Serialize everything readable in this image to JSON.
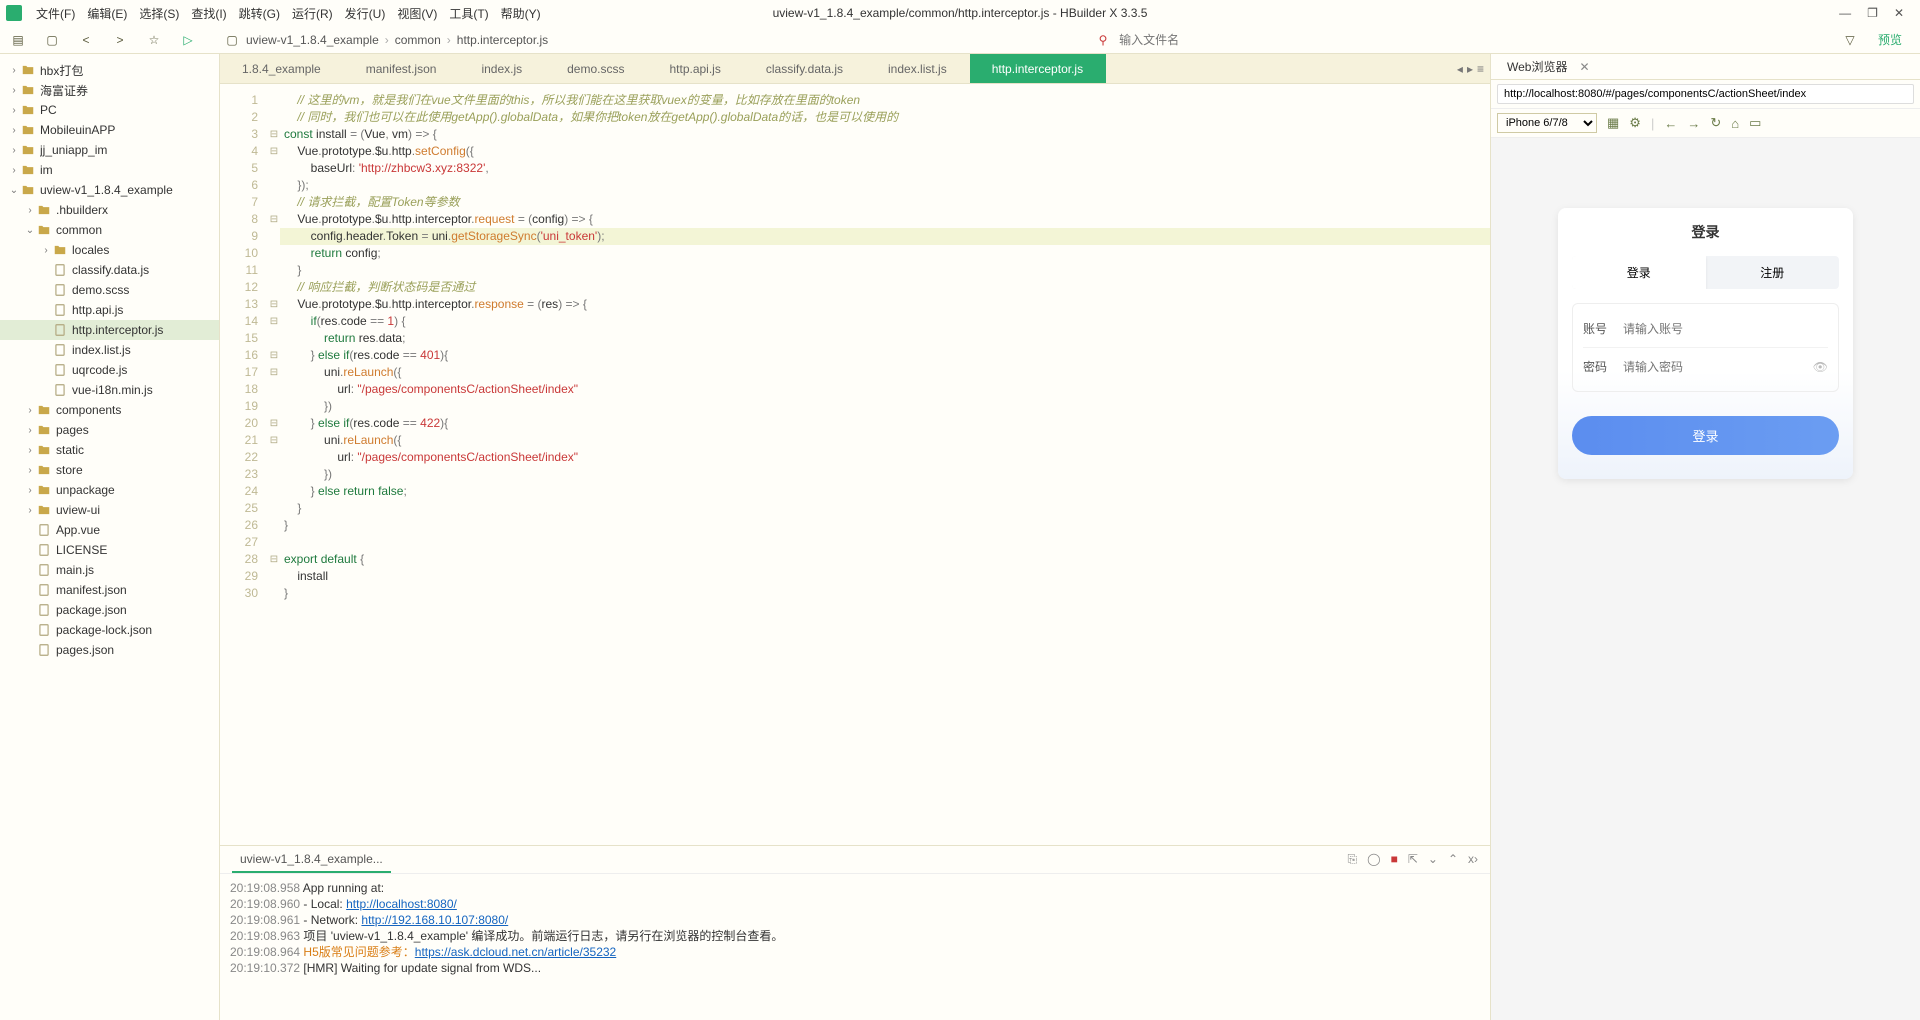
{
  "title": "uview-v1_1.8.4_example/common/http.interceptor.js - HBuilder X 3.3.5",
  "menus": [
    "文件(F)",
    "编辑(E)",
    "选择(S)",
    "查找(I)",
    "跳转(G)",
    "运行(R)",
    "发行(U)",
    "视图(V)",
    "工具(T)",
    "帮助(Y)"
  ],
  "breadcrumb": [
    "uview-v1_1.8.4_example",
    "common",
    "http.interceptor.js"
  ],
  "filename_placeholder": "输入文件名",
  "preview_label": "预览",
  "tree": [
    {
      "d": 0,
      "t": "folder",
      "a": ">",
      "l": "hbx打包"
    },
    {
      "d": 0,
      "t": "folder",
      "a": ">",
      "l": "海富证券"
    },
    {
      "d": 0,
      "t": "folder",
      "a": ">",
      "l": "PC"
    },
    {
      "d": 0,
      "t": "folder",
      "a": ">",
      "l": "MobileuinAPP"
    },
    {
      "d": 0,
      "t": "folder",
      "a": ">",
      "l": "jj_uniapp_im"
    },
    {
      "d": 0,
      "t": "folder",
      "a": ">",
      "l": "im"
    },
    {
      "d": 0,
      "t": "folder",
      "a": "v",
      "l": "uview-v1_1.8.4_example"
    },
    {
      "d": 1,
      "t": "folder",
      "a": ">",
      "l": ".hbuilderx"
    },
    {
      "d": 1,
      "t": "folder",
      "a": "v",
      "l": "common"
    },
    {
      "d": 2,
      "t": "folder",
      "a": ">",
      "l": "locales"
    },
    {
      "d": 2,
      "t": "file",
      "l": "classify.data.js"
    },
    {
      "d": 2,
      "t": "file",
      "l": "demo.scss"
    },
    {
      "d": 2,
      "t": "file",
      "l": "http.api.js"
    },
    {
      "d": 2,
      "t": "file",
      "l": "http.interceptor.js",
      "sel": true
    },
    {
      "d": 2,
      "t": "file",
      "l": "index.list.js"
    },
    {
      "d": 2,
      "t": "file",
      "l": "uqrcode.js"
    },
    {
      "d": 2,
      "t": "file",
      "l": "vue-i18n.min.js"
    },
    {
      "d": 1,
      "t": "folder",
      "a": ">",
      "l": "components"
    },
    {
      "d": 1,
      "t": "folder",
      "a": ">",
      "l": "pages"
    },
    {
      "d": 1,
      "t": "folder",
      "a": ">",
      "l": "static"
    },
    {
      "d": 1,
      "t": "folder",
      "a": ">",
      "l": "store"
    },
    {
      "d": 1,
      "t": "folder",
      "a": ">",
      "l": "unpackage"
    },
    {
      "d": 1,
      "t": "folder",
      "a": ">",
      "l": "uview-ui"
    },
    {
      "d": 1,
      "t": "file",
      "l": "App.vue"
    },
    {
      "d": 1,
      "t": "file",
      "l": "LICENSE"
    },
    {
      "d": 1,
      "t": "file",
      "l": "main.js"
    },
    {
      "d": 1,
      "t": "file",
      "l": "manifest.json"
    },
    {
      "d": 1,
      "t": "file",
      "l": "package.json"
    },
    {
      "d": 1,
      "t": "file",
      "l": "package-lock.json"
    },
    {
      "d": 1,
      "t": "file",
      "l": "pages.json"
    }
  ],
  "tabs": [
    "1.8.4_example",
    "manifest.json",
    "index.js",
    "demo.scss",
    "http.api.js",
    "classify.data.js",
    "index.list.js",
    "http.interceptor.js"
  ],
  "active_tab": 7,
  "code_lines": [
    {
      "n": 1,
      "f": "",
      "hl": false,
      "h": "    <span class='c-cm'>// 这里的vm，就是我们在vue文件里面的this，所以我们能在这里获取vuex的变量，比如存放在里面的token</span>"
    },
    {
      "n": 2,
      "f": "",
      "hl": false,
      "h": "    <span class='c-cm'>// 同时，我们也可以在此使用getApp().globalData，如果你把token放在getApp().globalData的话，也是可以使用的</span>"
    },
    {
      "n": 3,
      "f": "⊟",
      "hl": false,
      "h": "<span class='c-kw'>const</span> <span class='c-id'>install</span> <span class='c-pu'>=</span> <span class='c-pu'>(</span><span class='c-id'>Vue</span><span class='c-pu'>,</span> <span class='c-id'>vm</span><span class='c-pu'>)</span> <span class='c-pu'>=&gt;</span> <span class='c-pu'>{</span>"
    },
    {
      "n": 4,
      "f": "⊟",
      "hl": false,
      "h": "    <span class='c-id'>Vue</span><span class='c-pu'>.</span><span class='c-id'>prototype</span><span class='c-pu'>.</span><span class='c-id'>$u</span><span class='c-pu'>.</span><span class='c-id'>http</span><span class='c-pu'>.</span><span class='c-fn'>setConfig</span><span class='c-pu'>({</span>"
    },
    {
      "n": 5,
      "f": "",
      "hl": false,
      "h": "        <span class='c-id'>baseUrl</span><span class='c-pu'>:</span> <span class='c-str'>'http://zhbcw3.xyz:8322'</span><span class='c-pu'>,</span>"
    },
    {
      "n": 6,
      "f": "",
      "hl": false,
      "h": "    <span class='c-pu'>});</span>"
    },
    {
      "n": 7,
      "f": "",
      "hl": false,
      "h": "    <span class='c-cm'>// 请求拦截，配置Token等参数</span>"
    },
    {
      "n": 8,
      "f": "⊟",
      "hl": false,
      "h": "    <span class='c-id'>Vue</span><span class='c-pu'>.</span><span class='c-id'>prototype</span><span class='c-pu'>.</span><span class='c-id'>$u</span><span class='c-pu'>.</span><span class='c-id'>http</span><span class='c-pu'>.</span><span class='c-id'>interceptor</span><span class='c-pu'>.</span><span class='c-fn'>request</span> <span class='c-pu'>=</span> <span class='c-pu'>(</span><span class='c-id'>config</span><span class='c-pu'>)</span> <span class='c-pu'>=&gt;</span> <span class='c-pu'>{</span>"
    },
    {
      "n": 9,
      "f": "",
      "hl": true,
      "h": "        <span class='c-id'>config</span><span class='c-pu'>.</span><span class='c-id'>header</span><span class='c-pu'>.</span><span class='c-id'>Token</span> <span class='c-pu'>=</span> <span class='c-id'>uni</span><span class='c-pu'>.</span><span class='c-fn'>getStorageSync</span><span class='c-pu'>(</span><span class='c-str'>'uni_token'</span><span class='c-pu'>);</span>"
    },
    {
      "n": 10,
      "f": "",
      "hl": false,
      "h": "        <span class='c-kw'>return</span> <span class='c-id'>config</span><span class='c-pu'>;</span>"
    },
    {
      "n": 11,
      "f": "",
      "hl": false,
      "h": "    <span class='c-pu'>}</span>"
    },
    {
      "n": 12,
      "f": "",
      "hl": false,
      "h": "    <span class='c-cm'>// 响应拦截，判断状态码是否通过</span>"
    },
    {
      "n": 13,
      "f": "⊟",
      "hl": false,
      "h": "    <span class='c-id'>Vue</span><span class='c-pu'>.</span><span class='c-id'>prototype</span><span class='c-pu'>.</span><span class='c-id'>$u</span><span class='c-pu'>.</span><span class='c-id'>http</span><span class='c-pu'>.</span><span class='c-id'>interceptor</span><span class='c-pu'>.</span><span class='c-fn'>response</span> <span class='c-pu'>=</span> <span class='c-pu'>(</span><span class='c-id'>res</span><span class='c-pu'>)</span> <span class='c-pu'>=&gt;</span> <span class='c-pu'>{</span>"
    },
    {
      "n": 14,
      "f": "⊟",
      "hl": false,
      "h": "        <span class='c-kw'>if</span><span class='c-pu'>(</span><span class='c-id'>res</span><span class='c-pu'>.</span><span class='c-id'>code</span> <span class='c-pu'>==</span> <span class='c-num'>1</span><span class='c-pu'>)</span> <span class='c-pu'>{</span>"
    },
    {
      "n": 15,
      "f": "",
      "hl": false,
      "h": "            <span class='c-kw'>return</span> <span class='c-id'>res</span><span class='c-pu'>.</span><span class='c-id'>data</span><span class='c-pu'>;</span>"
    },
    {
      "n": 16,
      "f": "⊟",
      "hl": false,
      "h": "        <span class='c-pu'>}</span> <span class='c-kw'>else</span> <span class='c-kw'>if</span><span class='c-pu'>(</span><span class='c-id'>res</span><span class='c-pu'>.</span><span class='c-id'>code</span> <span class='c-pu'>==</span> <span class='c-num'>401</span><span class='c-pu'>){</span>"
    },
    {
      "n": 17,
      "f": "⊟",
      "hl": false,
      "h": "            <span class='c-id'>uni</span><span class='c-pu'>.</span><span class='c-fn'>reLaunch</span><span class='c-pu'>({</span>"
    },
    {
      "n": 18,
      "f": "",
      "hl": false,
      "h": "                <span class='c-id'>url</span><span class='c-pu'>:</span> <span class='c-str'>\"/pages/componentsC/actionSheet/index\"</span>"
    },
    {
      "n": 19,
      "f": "",
      "hl": false,
      "h": "            <span class='c-pu'>})</span>"
    },
    {
      "n": 20,
      "f": "⊟",
      "hl": false,
      "h": "        <span class='c-pu'>}</span> <span class='c-kw'>else</span> <span class='c-kw'>if</span><span class='c-pu'>(</span><span class='c-id'>res</span><span class='c-pu'>.</span><span class='c-id'>code</span> <span class='c-pu'>==</span> <span class='c-num'>422</span><span class='c-pu'>){</span>"
    },
    {
      "n": 21,
      "f": "⊟",
      "hl": false,
      "h": "            <span class='c-id'>uni</span><span class='c-pu'>.</span><span class='c-fn'>reLaunch</span><span class='c-pu'>({</span>"
    },
    {
      "n": 22,
      "f": "",
      "hl": false,
      "h": "                <span class='c-id'>url</span><span class='c-pu'>:</span> <span class='c-str'>\"/pages/componentsC/actionSheet/index\"</span>"
    },
    {
      "n": 23,
      "f": "",
      "hl": false,
      "h": "            <span class='c-pu'>})</span>"
    },
    {
      "n": 24,
      "f": "",
      "hl": false,
      "h": "        <span class='c-pu'>}</span> <span class='c-kw'>else</span> <span class='c-kw'>return</span> <span class='c-kw'>false</span><span class='c-pu'>;</span>"
    },
    {
      "n": 25,
      "f": "",
      "hl": false,
      "h": "    <span class='c-pu'>}</span>"
    },
    {
      "n": 26,
      "f": "",
      "hl": false,
      "h": "<span class='c-pu'>}</span>"
    },
    {
      "n": 27,
      "f": "",
      "hl": false,
      "h": ""
    },
    {
      "n": 28,
      "f": "⊟",
      "hl": false,
      "h": "<span class='c-kw'>export</span> <span class='c-kw'>default</span> <span class='c-pu'>{</span>"
    },
    {
      "n": 29,
      "f": "",
      "hl": false,
      "h": "    <span class='c-id'>install</span>"
    },
    {
      "n": 30,
      "f": "",
      "hl": false,
      "h": "<span class='c-pu'>}</span>"
    }
  ],
  "bottom_tab": "uview-v1_1.8.4_example...",
  "console": [
    {
      "ts": "20:19:08.958",
      "txt": "App running at:"
    },
    {
      "ts": "20:19:08.960",
      "txt": "- Local:   ",
      "link": "http://localhost:8080/"
    },
    {
      "ts": "20:19:08.961",
      "txt": "- Network: ",
      "link": "http://192.168.10.107:8080/"
    },
    {
      "ts": "20:19:08.963",
      "txt": "项目 'uview-v1_1.8.4_example' 编译成功。前端运行日志，请另行在浏览器的控制台查看。"
    },
    {
      "ts": "20:19:08.964",
      "warn": "H5版常见问题参考：",
      "link": "https://ask.dcloud.net.cn/article/35232"
    },
    {
      "ts": "20:19:10.372",
      "txt": "[HMR] Waiting for update signal from WDS..."
    }
  ],
  "webview": {
    "panel_title": "Web浏览器",
    "url": "http://localhost:8080/#/pages/componentsC/actionSheet/index",
    "device": "iPhone 6/7/8",
    "page_title": "登录",
    "tabs": [
      "登录",
      "注册"
    ],
    "fields": [
      {
        "label": "账号",
        "ph": "请输入账号"
      },
      {
        "label": "密码",
        "ph": "请输入密码",
        "eye": true
      }
    ],
    "login_btn": "登录"
  }
}
